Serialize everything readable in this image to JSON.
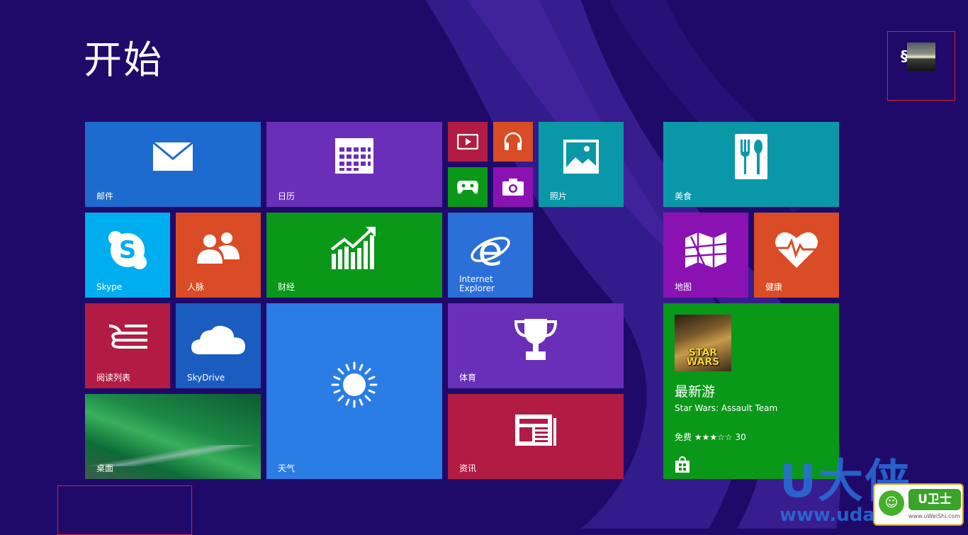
{
  "header": {
    "title": "开始"
  },
  "user": {
    "initial": "§"
  },
  "colors": {
    "background": "#1f0a6a",
    "mail": "#1e6bd0",
    "calendar": "#6a2fb8",
    "photos": "#0a98a8",
    "skype": "#00aef0",
    "people": "#d94c26",
    "finance": "#0a9818",
    "ie": "#2b6fd8",
    "reading": "#b21c44",
    "skydrive": "#1a5cc0",
    "weather": "#2b7de6",
    "sports": "#6a2fb8",
    "news": "#b21c44",
    "food": "#0a98a8",
    "maps": "#8a12b2",
    "health": "#d94c26",
    "store": "#0a9818"
  },
  "tiles": {
    "mail": {
      "label": "邮件",
      "icon": "envelope-icon"
    },
    "calendar": {
      "label": "日历",
      "icon": "calendar-icon"
    },
    "video": {
      "icon": "video-icon"
    },
    "music": {
      "icon": "headphones-icon"
    },
    "games": {
      "icon": "gamepad-icon"
    },
    "camera": {
      "icon": "camera-icon"
    },
    "photos": {
      "label": "照片",
      "icon": "picture-icon"
    },
    "skype": {
      "label": "Skype",
      "icon": "skype-icon"
    },
    "people": {
      "label": "人脉",
      "icon": "people-icon"
    },
    "finance": {
      "label": "财经",
      "icon": "chart-icon"
    },
    "ie": {
      "label_line1": "Internet",
      "label_line2": "Explorer",
      "icon": "ie-icon"
    },
    "reading": {
      "label": "阅读列表",
      "icon": "reading-list-icon"
    },
    "skydrive": {
      "label": "SkyDrive",
      "icon": "cloud-icon"
    },
    "desktop": {
      "label": "桌面"
    },
    "weather": {
      "label": "天气",
      "icon": "sun-icon"
    },
    "sports": {
      "label": "体育",
      "icon": "trophy-icon"
    },
    "news": {
      "label": "资讯",
      "icon": "newspaper-icon"
    },
    "food": {
      "label": "美食",
      "icon": "fork-spoon-icon"
    },
    "maps": {
      "label": "地图",
      "icon": "map-icon"
    },
    "health": {
      "label": "健康",
      "icon": "heart-pulse-icon"
    },
    "store": {
      "heading": "最新游",
      "app_name": "Star Wars: Assault Team",
      "price": "免费",
      "stars": "★★★☆☆",
      "rating_count": "30",
      "art_text": "STAR WARS",
      "icon": "store-bag-icon"
    }
  },
  "watermark": {
    "text": "U大侠",
    "url": "www.uda",
    "badge_name": "U卫士",
    "badge_url": "www.uWeiShi.com"
  }
}
